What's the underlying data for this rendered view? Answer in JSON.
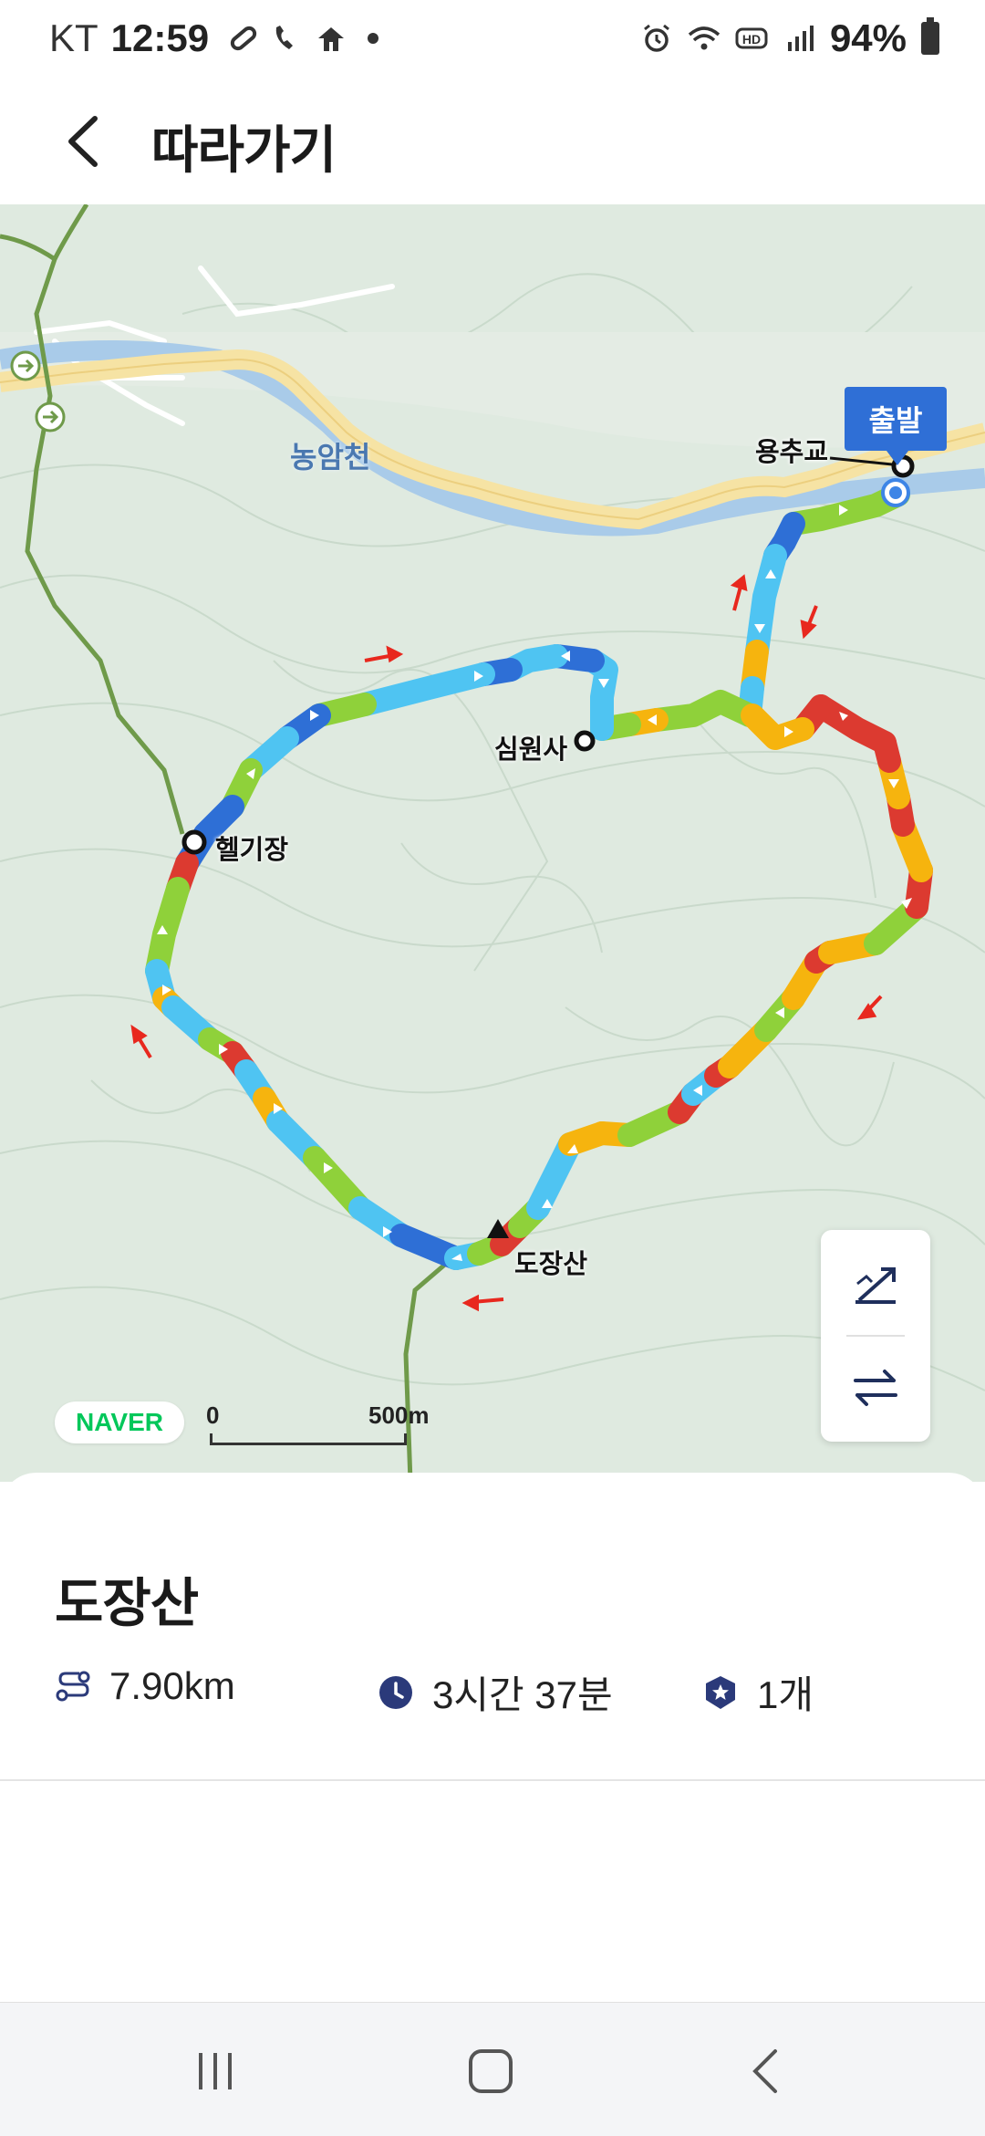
{
  "status_bar": {
    "carrier": "KT",
    "time": "12:59",
    "battery": "94%",
    "icons_left": [
      "link-icon",
      "wifi-call-icon",
      "transit-icon",
      "notification-dot-icon"
    ],
    "icons_right": [
      "alarm-icon",
      "wifi-icon",
      "hd-icon",
      "signal-icon",
      "battery-icon"
    ]
  },
  "header": {
    "title": "따라가기",
    "back_icon": "chevron-left-icon"
  },
  "map": {
    "river_label": "농암천",
    "start_badge": "출발",
    "places": {
      "bridge": "용추교",
      "temple": "심원사",
      "heliport": "헬기장",
      "peak": "도장산"
    },
    "scale": {
      "zero": "0",
      "distance": "500m"
    },
    "logo": "NAVER",
    "controls": [
      "elevation-icon",
      "swap-direction-icon"
    ],
    "colors": {
      "route_blue": "#2e6fd6",
      "route_cyan": "#4fc4f2",
      "route_green": "#8fd13a",
      "route_orange": "#f6b40e",
      "route_red": "#dc3a30",
      "road": "#f6e3a4",
      "river": "#a9cbe9"
    }
  },
  "summary": {
    "title": "도장산",
    "distance": "7.90km",
    "duration": "3시간 37분",
    "count": "1개",
    "icons": [
      "route-distance-icon",
      "clock-icon",
      "badge-star-icon"
    ]
  },
  "nav_bar": [
    "recents-button",
    "home-button",
    "back-button"
  ]
}
